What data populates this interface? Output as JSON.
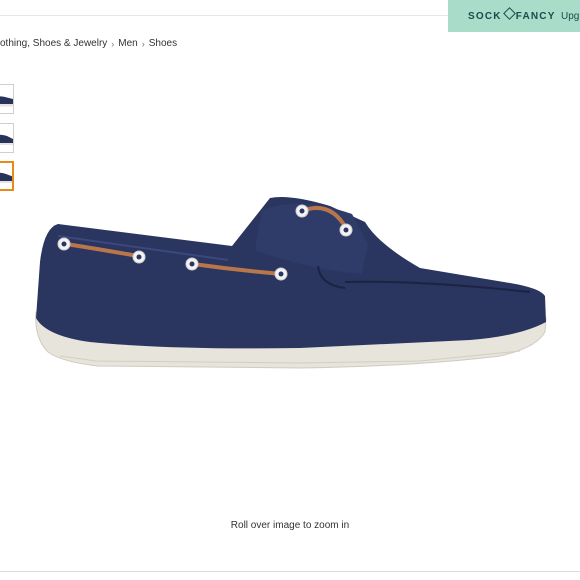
{
  "promo": {
    "brand_left": "SOCK",
    "brand_right": "FANCY",
    "upgrade": "Upg",
    "background": "#a9dcc9"
  },
  "breadcrumb": {
    "items": [
      "othing, Shoes & Jewelry",
      "Men",
      "Shoes"
    ],
    "separator": "›"
  },
  "thumbnails": [
    {
      "icon": "shoe-thumbnail-icon",
      "active": false
    },
    {
      "icon": "shoe-thumbnail-icon",
      "active": false
    },
    {
      "icon": "shoe-thumbnail-icon",
      "active": true
    }
  ],
  "product_image": {
    "icon": "navy-boat-shoe-image",
    "colors": {
      "upper": "#27335a",
      "sole": "#e7e4db",
      "laces": "#b8764a"
    }
  },
  "zoom_hint": "Roll over image to zoom in",
  "accent": "#e88a16"
}
